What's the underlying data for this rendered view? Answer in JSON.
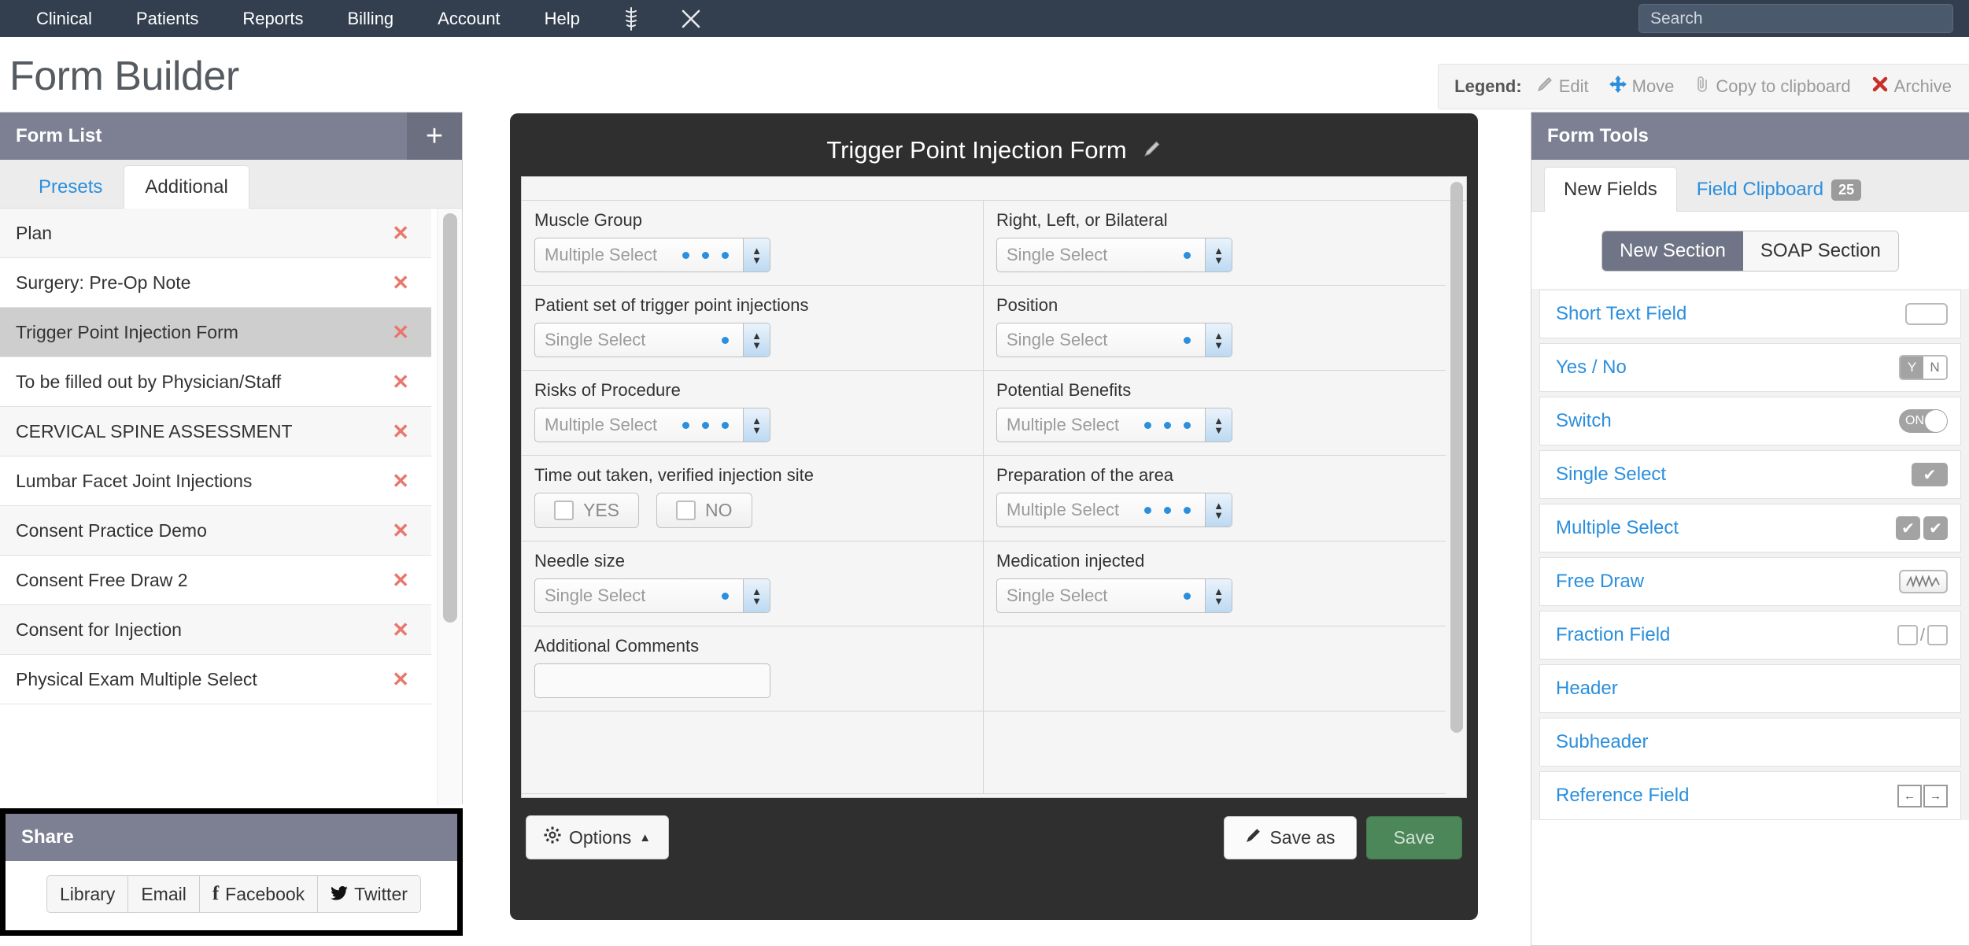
{
  "topnav": {
    "items": [
      "Clinical",
      "Patients",
      "Reports",
      "Billing",
      "Account",
      "Help"
    ],
    "icons": [
      "caduceus-icon",
      "crossed-scalpels-icon"
    ],
    "search_placeholder": "Search"
  },
  "page": {
    "title": "Form Builder"
  },
  "legend": {
    "label": "Legend:",
    "items": [
      {
        "icon": "pencil-icon",
        "label": "Edit",
        "color": "#9a9a9a"
      },
      {
        "icon": "move-arrows-icon",
        "label": "Move",
        "color": "#9a9a9a"
      },
      {
        "icon": "paperclip-icon",
        "label": "Copy to clipboard",
        "color": "#9a9a9a"
      },
      {
        "icon": "red-x-icon",
        "label": "Archive",
        "color": "#9a9a9a"
      }
    ]
  },
  "form_list": {
    "title": "Form List",
    "add_label": "+",
    "tabs": [
      {
        "label": "Presets",
        "active": false
      },
      {
        "label": "Additional",
        "active": true
      }
    ],
    "items": [
      {
        "label": "Plan",
        "selected": false
      },
      {
        "label": "Surgery: Pre-Op Note",
        "selected": false
      },
      {
        "label": "Trigger Point Injection Form",
        "selected": true
      },
      {
        "label": "To be filled out by Physician/Staff",
        "selected": false
      },
      {
        "label": "CERVICAL SPINE ASSESSMENT",
        "selected": false
      },
      {
        "label": "Lumbar Facet Joint Injections",
        "selected": false
      },
      {
        "label": "Consent Practice Demo",
        "selected": false
      },
      {
        "label": "Consent Free Draw 2",
        "selected": false
      },
      {
        "label": "Consent for Injection",
        "selected": false
      },
      {
        "label": "Physical Exam Multiple Select",
        "selected": false
      }
    ],
    "delete_icon": "✕"
  },
  "share": {
    "title": "Share",
    "buttons": [
      {
        "label": "Library",
        "icon": ""
      },
      {
        "label": "Email",
        "icon": ""
      },
      {
        "label": "Facebook",
        "icon": "facebook-icon"
      },
      {
        "label": "Twitter",
        "icon": "twitter-icon"
      }
    ]
  },
  "builder": {
    "form_title": "Trigger Point Injection Form",
    "edit_icon": "pencil-icon",
    "rows": [
      [
        {
          "label": "Muscle Group",
          "type": "select",
          "value": "Multiple Select",
          "dots": 3
        },
        {
          "label": "Right, Left, or Bilateral",
          "type": "select",
          "value": "Single Select",
          "dots": 1
        }
      ],
      [
        {
          "label": "Patient set of trigger point injections",
          "type": "select",
          "value": "Single Select",
          "dots": 1
        },
        {
          "label": "Position",
          "type": "select",
          "value": "Single Select",
          "dots": 1
        }
      ],
      [
        {
          "label": "Risks of Procedure",
          "type": "select",
          "value": "Multiple Select",
          "dots": 3
        },
        {
          "label": "Potential Benefits",
          "type": "select",
          "value": "Multiple Select",
          "dots": 3
        }
      ],
      [
        {
          "label": "Time out taken, verified injection site",
          "type": "yesno",
          "yes_label": "YES",
          "no_label": "NO"
        },
        {
          "label": "Preparation of the area",
          "type": "select",
          "value": "Multiple Select",
          "dots": 3
        }
      ],
      [
        {
          "label": "Needle size",
          "type": "select",
          "value": "Single Select",
          "dots": 1
        },
        {
          "label": "Medication injected",
          "type": "select",
          "value": "Single Select",
          "dots": 1
        }
      ],
      [
        {
          "label": "Additional Comments",
          "type": "text",
          "value": ""
        },
        {
          "label": "",
          "type": "empty"
        }
      ],
      [
        {
          "label": "",
          "type": "empty"
        },
        {
          "label": "",
          "type": "empty"
        }
      ]
    ],
    "footer": {
      "options_label": "Options",
      "options_icon": "gear-icon",
      "options_caret": "▲",
      "save_as_label": "Save as",
      "save_as_icon": "pencil-icon",
      "save_label": "Save",
      "save_color": "#4b8758"
    }
  },
  "form_tools": {
    "title": "Form Tools",
    "tabs": [
      {
        "label": "New Fields",
        "active": true,
        "badge": null
      },
      {
        "label": "Field Clipboard",
        "active": false,
        "badge": "25"
      }
    ],
    "segments": [
      {
        "label": "New Section",
        "active": true
      },
      {
        "label": "SOAP Section",
        "active": false
      }
    ],
    "fields": [
      {
        "label": "Short Text Field",
        "icon": "text-input-icon"
      },
      {
        "label": "Yes / No",
        "icon": "yes-no-toggle-icon",
        "yes": "Y",
        "no": "N"
      },
      {
        "label": "Switch",
        "icon": "switch-icon",
        "state": "ON"
      },
      {
        "label": "Single Select",
        "icon": "single-checkmark-icon"
      },
      {
        "label": "Multiple Select",
        "icon": "double-checkmark-icon"
      },
      {
        "label": "Free Draw",
        "icon": "scribble-icon"
      },
      {
        "label": "Fraction Field",
        "icon": "fraction-icon"
      },
      {
        "label": "Header",
        "icon": null
      },
      {
        "label": "Subheader",
        "icon": null
      },
      {
        "label": "Reference Field",
        "icon": "reference-arrow-icon"
      }
    ]
  },
  "colors": {
    "navbar": "#333f4f",
    "panel_header": "#7c8092",
    "link_blue": "#2b8fdd",
    "delete_red": "#e8776d",
    "builder_dark": "#2f2f2f",
    "save_green": "#4b8758"
  }
}
